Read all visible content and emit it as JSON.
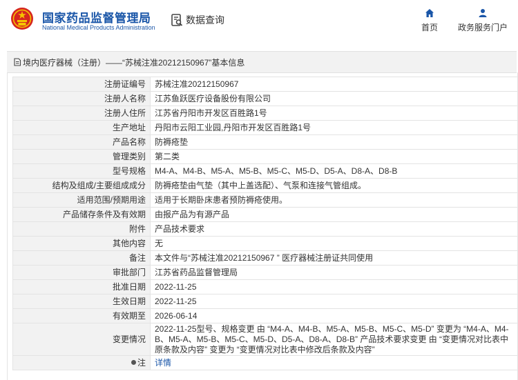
{
  "header": {
    "agency_cn": "国家药品监督管理局",
    "agency_en": "National Medical Products Administration",
    "data_query": "数据查询",
    "nav_home": "首页",
    "nav_portal": "政务服务门户"
  },
  "breadcrumb": "境内医疗器械（注册）——“苏械注准20212150967”基本信息",
  "rows": [
    {
      "label": "注册证编号",
      "value": "苏械注准20212150967"
    },
    {
      "label": "注册人名称",
      "value": "江苏鱼跃医疗设备股份有限公司"
    },
    {
      "label": "注册人住所",
      "value": "江苏省丹阳市开发区百胜路1号"
    },
    {
      "label": "生产地址",
      "value": "丹阳市云阳工业园,丹阳市开发区百胜路1号"
    },
    {
      "label": "产品名称",
      "value": "防褥疮垫"
    },
    {
      "label": "管理类别",
      "value": "第二类"
    },
    {
      "label": "型号规格",
      "value": "M4-A、M4-B、M5-A、M5-B、M5-C、M5-D、D5-A、D8-A、D8-B"
    },
    {
      "label": "结构及组成/主要组成成分",
      "value": "防褥疮垫由气垫（其中上盖选配）、气泵和连接气管组成。"
    },
    {
      "label": "适用范围/预期用途",
      "value": "适用于长期卧床患者预防褥疮使用。"
    },
    {
      "label": "产品储存条件及有效期",
      "value": "由报产品为有源产品"
    },
    {
      "label": "附件",
      "value": "产品技术要求"
    },
    {
      "label": "其他内容",
      "value": "无"
    },
    {
      "label": "备注",
      "value": "本文件与“苏械注准20212150967 ” 医疗器械注册证共同使用"
    },
    {
      "label": "审批部门",
      "value": "江苏省药品监督管理局"
    },
    {
      "label": "批准日期",
      "value": "2022-11-25"
    },
    {
      "label": "生效日期",
      "value": "2022-11-25"
    },
    {
      "label": "有效期至",
      "value": "2026-06-14"
    },
    {
      "label": "变更情况",
      "value": "2022-11-25型号、规格变更 由 “M4-A、M4-B、M5-A、M5-B、M5-C、M5-D” 变更为 “M4-A、M4-B、M5-A、M5-B、M5-C、M5-D、D5-A、D8-A、D8-B” 产品技术要求变更 由 “变更情况对比表中原条款及内容” 变更为 “变更情况对比表中修改后条款及内容”"
    },
    {
      "label": "注",
      "value": "详情"
    }
  ],
  "icons": [
    "national-emblem-icon",
    "data-query-icon",
    "home-icon",
    "user-icon",
    "document-icon",
    "pin-icon"
  ],
  "colors": {
    "brand": "#1a56a8",
    "emblem_red": "#d6261f",
    "emblem_gold": "#f5c400",
    "label_bg": "#f2f2f2"
  }
}
